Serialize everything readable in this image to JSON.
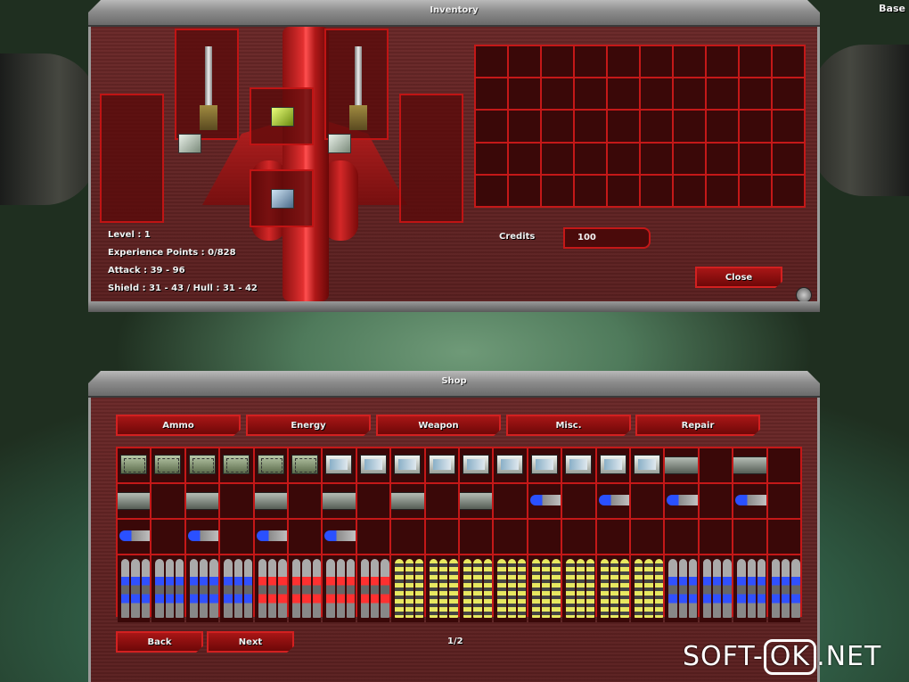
{
  "corner_label": "Base",
  "inventory": {
    "title": "Inventory",
    "stats": {
      "level": "Level : 1",
      "experience": "Experience Points : 0/828",
      "attack": "Attack : 39 - 96",
      "shield_hull": "Shield : 31 - 43 / Hull : 31 - 42"
    },
    "credits_label": "Credits",
    "credits_value": "100",
    "close_label": "Close"
  },
  "shop": {
    "title": "Shop",
    "tabs": [
      "Ammo",
      "Energy",
      "Weapon",
      "Misc.",
      "Repair"
    ],
    "rows": [
      [
        "ammo-green",
        "ammo-green",
        "ammo-green",
        "ammo-green",
        "ammo-green",
        "ammo-green",
        "ammo-white",
        "ammo-white",
        "ammo-white",
        "ammo-white",
        "ammo-white",
        "ammo-white",
        "ammo-white",
        "ammo-white",
        "ammo-white",
        "ammo-white",
        "crate",
        "",
        "crate",
        ""
      ],
      [
        "crate",
        "",
        "crate",
        "",
        "crate",
        "",
        "crate",
        "",
        "crate",
        "",
        "crate",
        "",
        "missile",
        "",
        "missile",
        "",
        "missile",
        "",
        "missile",
        ""
      ],
      [
        "missile",
        "",
        "missile",
        "",
        "missile",
        "",
        "missile",
        "",
        "",
        "",
        "",
        "",
        "",
        "",
        "",
        "",
        "",
        "",
        "",
        ""
      ],
      [
        "rockets-blue",
        "rockets-blue",
        "rockets-blue",
        "rockets-blue",
        "rockets-red",
        "rockets-red",
        "rockets-red",
        "rockets-red",
        "rockets-yellow",
        "rockets-yellow",
        "rockets-yellow",
        "rockets-yellow",
        "rockets-yellow",
        "rockets-yellow",
        "rockets-yellow",
        "rockets-yellow",
        "rockets-blue",
        "rockets-blue",
        "rockets-blue",
        "rockets-blue"
      ]
    ],
    "back_label": "Back",
    "next_label": "Next",
    "page": "1/2"
  },
  "watermark": {
    "left": "SOFT-",
    "mid": "OK",
    "right": ".NET"
  }
}
